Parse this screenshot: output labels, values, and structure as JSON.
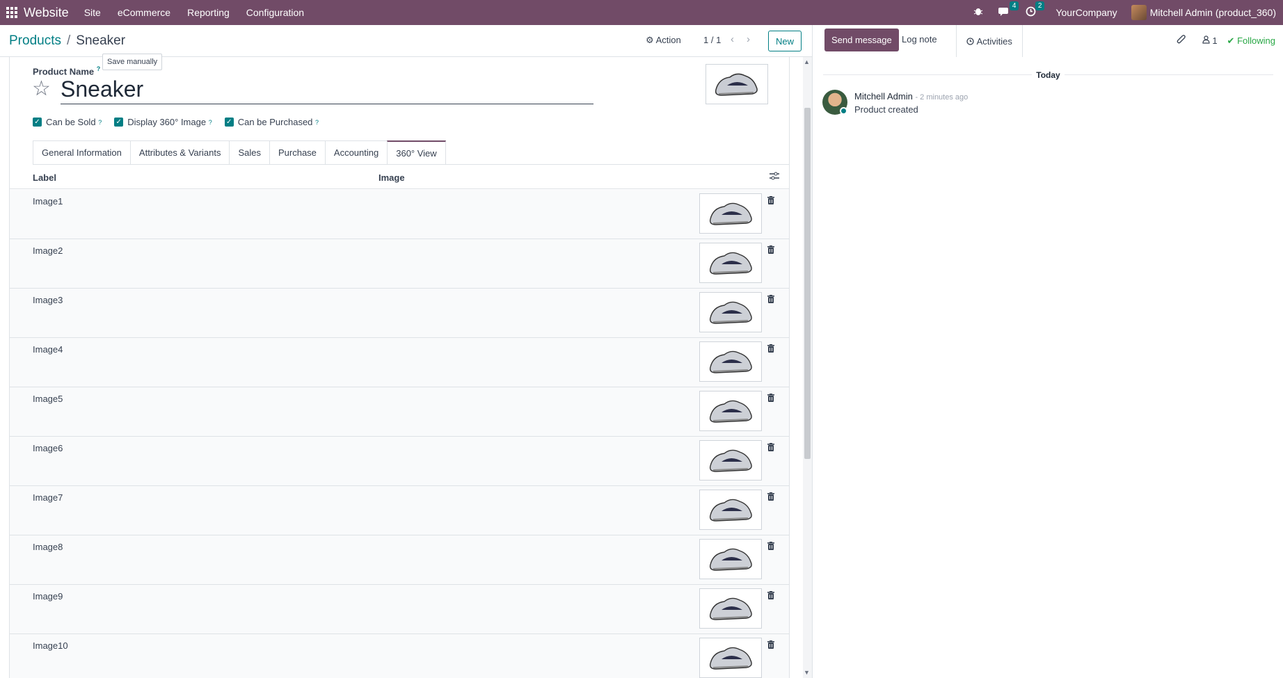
{
  "navbar": {
    "brand": "Website",
    "menu": [
      "Site",
      "eCommerce",
      "Reporting",
      "Configuration"
    ],
    "messages_count": "4",
    "activities_count": "2",
    "company": "YourCompany",
    "user": "Mitchell Admin (product_360)"
  },
  "control": {
    "breadcrumb_root": "Products",
    "breadcrumb_separator": "/",
    "breadcrumb_current": "Sneaker",
    "tooltip": "Save manually",
    "action_label": "Action",
    "pager": "1 / 1",
    "new_label": "New"
  },
  "form": {
    "name_label": "Product Name",
    "help_mark": "?",
    "name_value": "Sneaker",
    "checkboxes": [
      {
        "label": "Can be Sold",
        "checked": true
      },
      {
        "label": "Display 360° Image",
        "checked": true
      },
      {
        "label": "Can be Purchased",
        "checked": true
      }
    ],
    "tabs": [
      "General Information",
      "Attributes & Variants",
      "Sales",
      "Purchase",
      "Accounting",
      "360° View"
    ],
    "active_tab": "360° View"
  },
  "table": {
    "col_label": "Label",
    "col_image": "Image",
    "rows": [
      "Image1",
      "Image2",
      "Image3",
      "Image4",
      "Image5",
      "Image6",
      "Image7",
      "Image8",
      "Image9",
      "Image10"
    ]
  },
  "chatter": {
    "send_message": "Send message",
    "log_note": "Log note",
    "activities": "Activities",
    "followers_count": "1",
    "following": "Following",
    "today": "Today",
    "message": {
      "author": "Mitchell Admin",
      "time": "- 2 minutes ago",
      "body": "Product created"
    }
  },
  "colors": {
    "brand": "#714B67",
    "accent": "#017e84",
    "following": "#28a745"
  }
}
